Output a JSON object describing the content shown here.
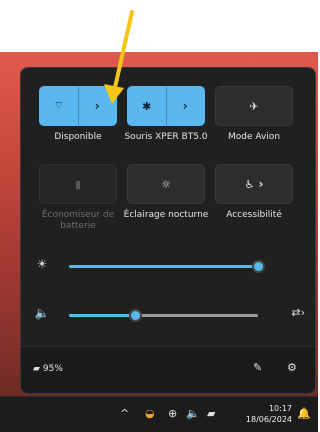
{
  "quick_settings": {
    "tiles": [
      {
        "id": "wifi",
        "label": "Disponible",
        "icon": "wifi-icon",
        "glyph": "⌔",
        "state": "on",
        "split": true
      },
      {
        "id": "bluetooth",
        "label": "Souris XPER BT5.0",
        "icon": "bluetooth-icon",
        "glyph": "✱",
        "state": "on",
        "split": true
      },
      {
        "id": "airplane",
        "label": "Mode Avion",
        "icon": "airplane-icon",
        "glyph": "✈",
        "state": "off",
        "split": false
      },
      {
        "id": "battery-saver",
        "label": "Économiseur de batterie",
        "icon": "battery-saver-icon",
        "glyph": "▮",
        "state": "disabled",
        "split": false
      },
      {
        "id": "night-light",
        "label": "Éclairage nocturne",
        "icon": "night-light-icon",
        "glyph": "☼",
        "state": "off",
        "split": false
      },
      {
        "id": "accessibility",
        "label": "Accessibilité",
        "icon": "accessibility-icon",
        "glyph": "♿",
        "state": "off",
        "split": false,
        "has_chevron": true
      }
    ],
    "chevron_glyph": "›",
    "brightness": {
      "icon": "brightness-icon",
      "glyph": "☀",
      "level": 1.0
    },
    "volume": {
      "icon": "speaker-icon",
      "glyph": "🔈",
      "level": 0.35,
      "output_icon": "audio-output-icon",
      "output_glyph": "⇄›"
    },
    "footer": {
      "battery_icon": "battery-icon",
      "battery_glyph": "▰",
      "battery_text": "95%",
      "edit_icon": "pencil-icon",
      "edit_glyph": "✎",
      "settings_icon": "gear-icon",
      "settings_glyph": "⚙"
    }
  },
  "taskbar": {
    "chevron_glyph": "^",
    "app_glyph": "◒",
    "network_glyph": "⊕",
    "speaker_glyph": "🔈",
    "battery_glyph": "▰",
    "time": "10:17",
    "date": "18/06/2024",
    "notification_glyph": "🔔"
  },
  "colors": {
    "accent": "#5ab8ee",
    "panel": "#202020",
    "arrow": "#f5c518"
  }
}
